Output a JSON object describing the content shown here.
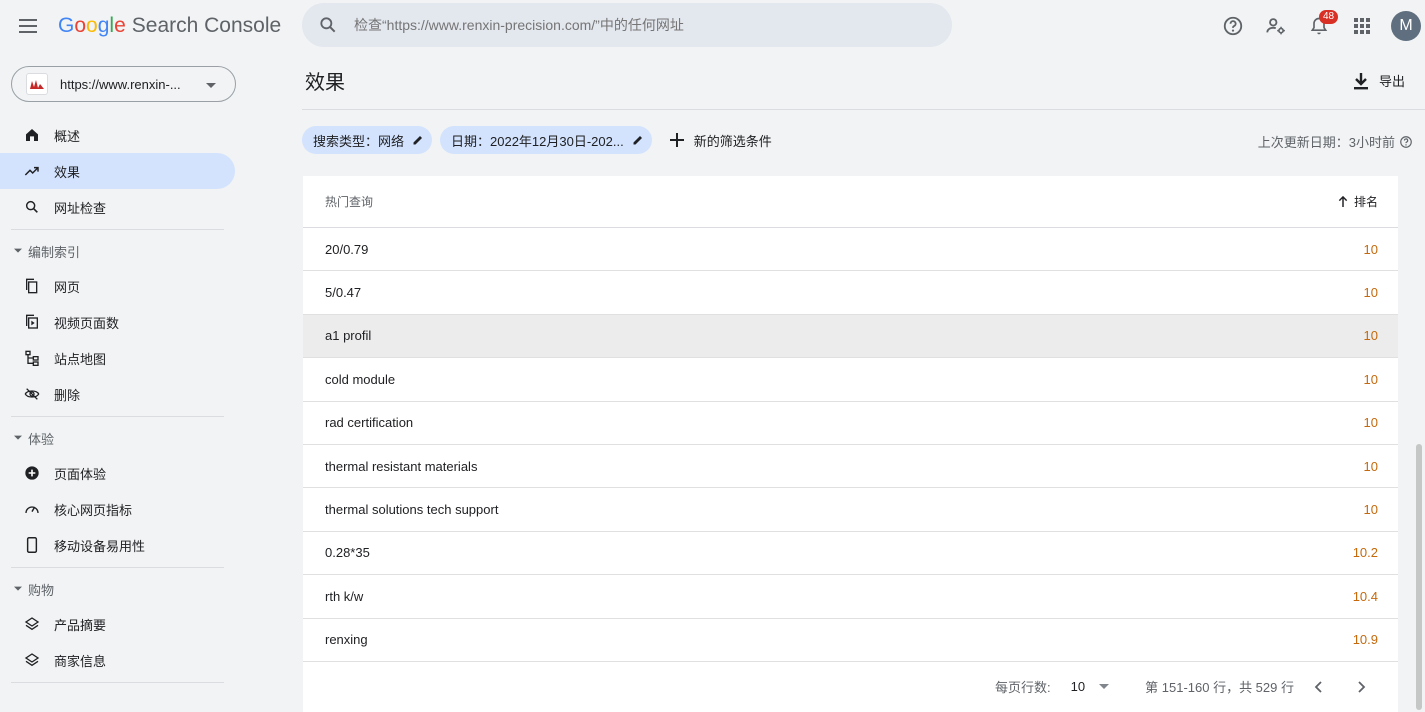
{
  "header": {
    "logo": {
      "g": "G",
      "o1": "o",
      "o2": "o",
      "g2": "g",
      "l": "l",
      "e": "e",
      "product": "Search Console"
    },
    "search_placeholder": "检查“https://www.renxin-precision.com/”中的任何网址",
    "notification_count": "48",
    "avatar_letter": "M"
  },
  "sidebar": {
    "property": "https://www.renxin-...",
    "items_top": [
      {
        "label": "概述",
        "icon": "home-icon"
      },
      {
        "label": "效果",
        "icon": "trending-up-icon",
        "active": true
      },
      {
        "label": "网址检查",
        "icon": "search-icon"
      }
    ],
    "sections": [
      {
        "label": "编制索引",
        "items": [
          "网页",
          "视频页面数",
          "站点地图",
          "删除"
        ]
      },
      {
        "label": "体验",
        "items": [
          "页面体验",
          "核心网页指标",
          "移动设备易用性"
        ]
      },
      {
        "label": "购物",
        "items": [
          "产品摘要",
          "商家信息"
        ]
      }
    ]
  },
  "main": {
    "title": "效果",
    "export_label": "导出",
    "chips": [
      "搜索类型：网络",
      "日期：2022年12月30日-202..."
    ],
    "add_filter": "新的筛选条件",
    "last_updated": "上次更新日期：3小时前",
    "table": {
      "col_query": "热门查询",
      "col_position": "排名",
      "rows": [
        {
          "query": "20/0.79",
          "position": "10"
        },
        {
          "query": "5/0.47",
          "position": "10"
        },
        {
          "query": "a1 profil",
          "position": "10"
        },
        {
          "query": "cold module",
          "position": "10"
        },
        {
          "query": "rad certification",
          "position": "10"
        },
        {
          "query": "thermal resistant materials",
          "position": "10"
        },
        {
          "query": "thermal solutions tech support",
          "position": "10"
        },
        {
          "query": "0.28*35",
          "position": "10.2"
        },
        {
          "query": "rth k/w",
          "position": "10.4"
        },
        {
          "query": "renxing",
          "position": "10.9"
        }
      ]
    },
    "pager": {
      "rows_per_page_label": "每页行数:",
      "rows_per_page": "10",
      "range": "第 151-160 行，共 529 行"
    }
  },
  "colors": {
    "accent": "#d3e3fd",
    "position": "#c5690c"
  }
}
